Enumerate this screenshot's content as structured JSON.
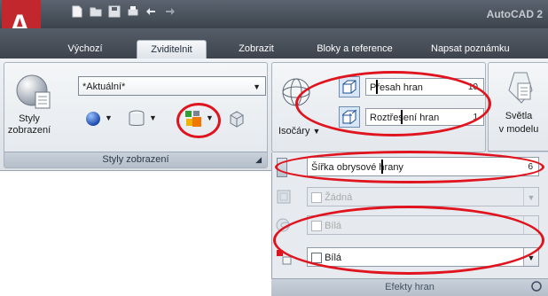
{
  "app": {
    "title": "AutoCAD 2"
  },
  "tabs": [
    {
      "label": "Výchozí"
    },
    {
      "label": "Zviditelnit"
    },
    {
      "label": "Zobrazit"
    },
    {
      "label": "Bloky a reference"
    },
    {
      "label": "Napsat poznámku"
    }
  ],
  "active_tab": "Zviditelnit",
  "visual_styles": {
    "current_style": "*Aktuální*",
    "styles_button_label_line1": "Styly",
    "styles_button_label_line2": "zobrazení",
    "panel_title": "Styly zobrazení"
  },
  "edges": {
    "isolines_label": "Isočáry",
    "overhang_label": "Přesah hran",
    "overhang_value": "10",
    "jitter_label": "Roztřesení hran",
    "jitter_value": "1",
    "lights_label_line1": "Světla",
    "lights_label_line2": "v modelu",
    "silhouette_label": "Šířka obrysové hrany",
    "silhouette_value": "6",
    "row1_value": "Žádná",
    "row2_value": "Bílá",
    "row3_value": "Bílá",
    "panel_title": "Efekty hran"
  },
  "colors": {
    "highlight_ring": "#e0141e",
    "title_bar": "#4a515b",
    "ribbon": "#e3e7ec"
  }
}
